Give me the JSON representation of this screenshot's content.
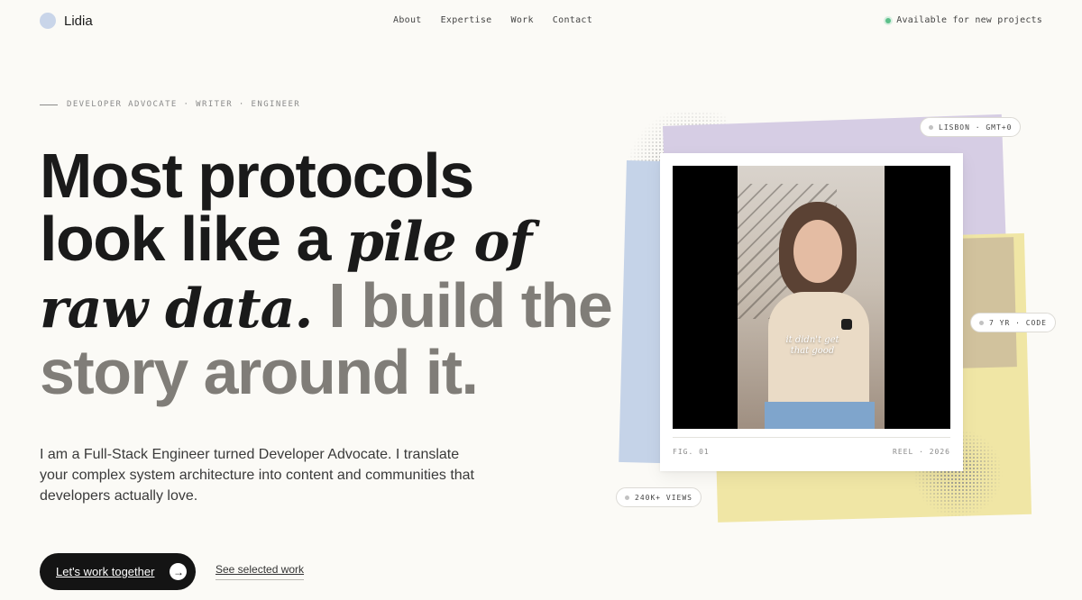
{
  "brand": {
    "name": "Lidia"
  },
  "nav": {
    "items": [
      "About",
      "Expertise",
      "Work",
      "Contact"
    ]
  },
  "status": {
    "label": "Available for new projects",
    "color": "#5cbf8a"
  },
  "hero": {
    "eyebrow": "DEVELOPER ADVOCATE · WRITER · ENGINEER",
    "headline": {
      "line1": "Most protocols",
      "line2_plain": "look like a ",
      "line2_serif": "pile of",
      "line3_serif": "raw data.",
      "line3_muted": " I build the",
      "line4_muted": "story around it."
    },
    "lede": "I am a Full-Stack Engineer turned Developer Advocate. I translate your complex system architecture into content and communities that developers actually love.",
    "primary_cta": "Let's work together",
    "secondary_cta": "See selected work"
  },
  "visual": {
    "chips": {
      "location": "LISBON · GMT+0",
      "experience": "7 YR · CODE",
      "views": "240K+ VIEWS"
    },
    "video_caption": "it didn't get that good",
    "figure_label": "FIG. 01",
    "reel_label": "REEL · 2026",
    "colors": {
      "blue": "#c5d3e8",
      "purple": "#d6cde4",
      "yellow": "#f0e6a5",
      "tan": "#cfc09c"
    }
  },
  "icons": {
    "cta_arrow": "arrow-right-icon"
  }
}
